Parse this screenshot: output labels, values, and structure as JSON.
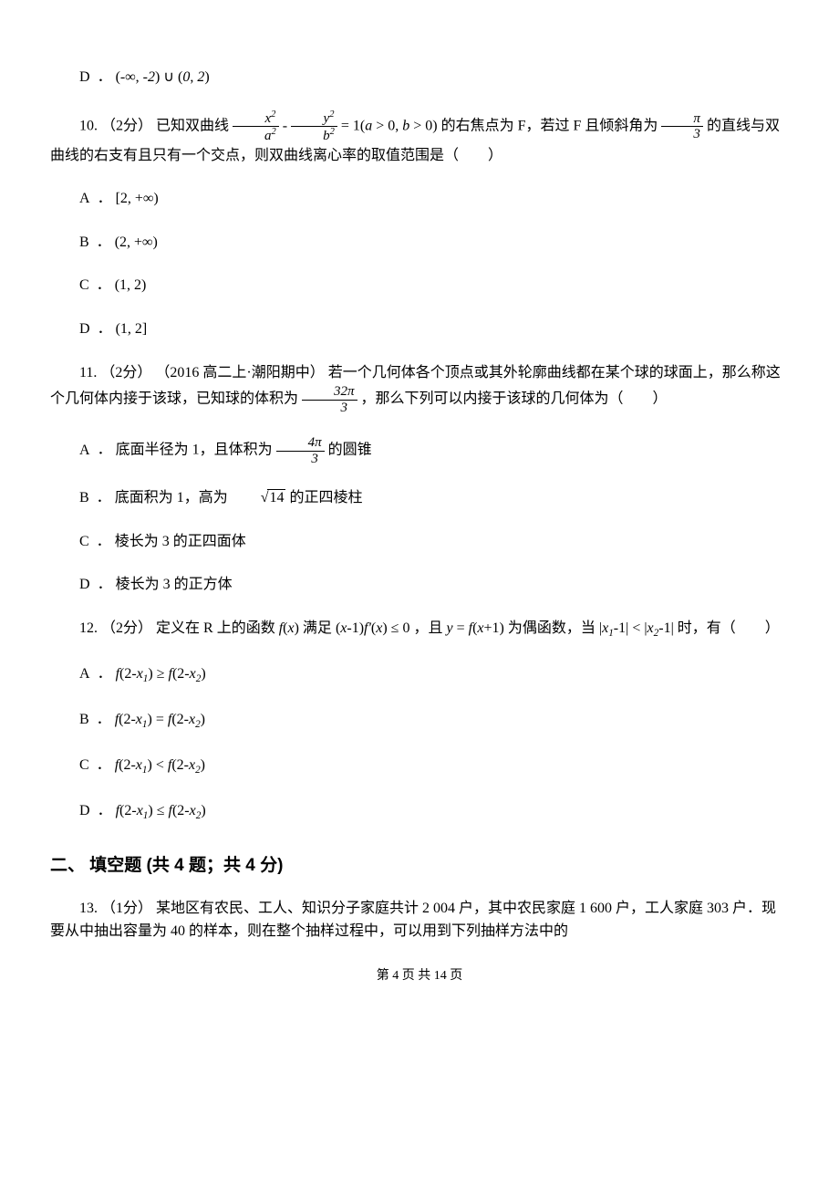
{
  "q9": {
    "options": {
      "D": {
        "label": "D",
        "expr": "(-∞, -2) ∪ (0, 2)"
      }
    }
  },
  "q10": {
    "number": "10.",
    "points": "（2分）",
    "text1": "已知双曲线",
    "eq_lhs_num1": "x",
    "eq_lhs_den1": "a",
    "eq_lhs_num2": "y",
    "eq_lhs_den2": "b",
    "eq_cond": " = 1(a > 0, b > 0)",
    "text2": "的右焦点为 F，若过 F 且倾斜角为",
    "angle_num": "π",
    "angle_den": "3",
    "text3": "的直线与双曲线的右支有且只有一个交点，则双曲线离心率的取值范围是（　　）",
    "options": {
      "A": {
        "label": "A",
        "expr": "[2, +∞)"
      },
      "B": {
        "label": "B",
        "expr": "(2, +∞)"
      },
      "C": {
        "label": "C",
        "expr": "(1, 2)"
      },
      "D": {
        "label": "D",
        "expr": "(1, 2]"
      }
    }
  },
  "q11": {
    "number": "11.",
    "points": "（2分）",
    "source": "（2016 高二上·潮阳期中）",
    "text1": "若一个几何体各个顶点或其外轮廓曲线都在某个球的球面上，那么称这个几何体内接于该球，已知球的体积为 ",
    "vol_num": "32π",
    "vol_den": "3",
    "text2": " ，那么下列可以内接于该球的几何体为（　　）",
    "options": {
      "A": {
        "label": "A",
        "prefix": "底面半径为 1，且体积为 ",
        "frac_num": "4π",
        "frac_den": "3",
        "suffix": " 的圆锥"
      },
      "B": {
        "label": "B",
        "prefix": "底面积为 1，高为 ",
        "sqrt": "14",
        "suffix": " 的正四棱柱"
      },
      "C": {
        "label": "C",
        "text": "棱长为 3 的正四面体"
      },
      "D": {
        "label": "D",
        "text": "棱长为 3 的正方体"
      }
    }
  },
  "q12": {
    "number": "12.",
    "points": "（2分）",
    "text1": "定义在 R 上的函数",
    "fx": "f(x)",
    "text2": "满足",
    "cond1": "(x-1)f'(x) ≤ 0",
    "text3": "，且",
    "yfx": "y = f(x+1)",
    "text4": "为偶函数，当",
    "cond2": "|x₁-1| < |x₂-1|",
    "text5": "时，有（　　）",
    "options": {
      "A": {
        "label": "A",
        "expr": "f(2-x₁) ≥ f(2-x₂)"
      },
      "B": {
        "label": "B",
        "expr": "f(2-x₁) = f(2-x₂)"
      },
      "C": {
        "label": "C",
        "expr": "f(2-x₁) < f(2-x₂)"
      },
      "D": {
        "label": "D",
        "expr": "f(2-x₁) ≤ f(2-x₂)"
      }
    }
  },
  "section2": {
    "title": "二、 填空题 (共 4 题；共 4 分)"
  },
  "q13": {
    "number": "13.",
    "points": "（1分）",
    "text": "某地区有农民、工人、知识分子家庭共计 2 004 户，其中农民家庭 1 600 户，工人家庭 303 户．现要从中抽出容量为 40 的样本，则在整个抽样过程中，可以用到下列抽样方法中的"
  },
  "footer": {
    "text": "第 4 页 共 14 页"
  }
}
